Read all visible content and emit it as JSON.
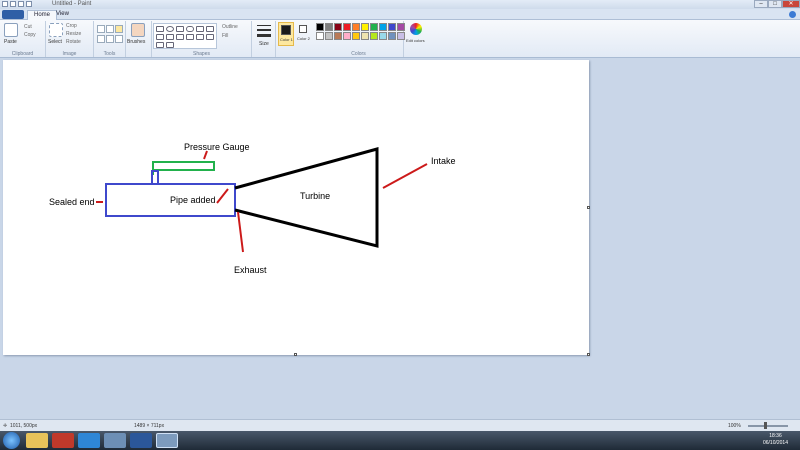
{
  "window": {
    "title": "Untitled - Paint"
  },
  "tabs": [
    {
      "label": "Home"
    },
    {
      "label": "View"
    }
  ],
  "ribbon": {
    "clipboard": {
      "paste_label": "Paste",
      "cut_label": "Cut",
      "copy_label": "Copy",
      "group_label": "Clipboard"
    },
    "image": {
      "select_label": "Select",
      "crop_label": "Crop",
      "resize_label": "Resize",
      "rotate_label": "Rotate",
      "group_label": "Image"
    },
    "tools": {
      "group_label": "Tools"
    },
    "brushes": {
      "label": "Brushes"
    },
    "shapes": {
      "outline_label": "Outline",
      "fill_label": "Fill",
      "group_label": "Shapes"
    },
    "size": {
      "label": "Size"
    },
    "color1": {
      "label": "Color 1",
      "value": "#1a1a1a"
    },
    "color2": {
      "label": "Color 2",
      "value": "#ffffff"
    },
    "colors": {
      "group_label": "Colors",
      "palette": [
        "#000000",
        "#7f7f7f",
        "#880015",
        "#ed1c24",
        "#ff7f27",
        "#fff200",
        "#22b14c",
        "#00a2e8",
        "#3f48cc",
        "#a349a4",
        "#ffffff",
        "#c3c3c3",
        "#b97a57",
        "#ffaec9",
        "#ffc90e",
        "#efe4b0",
        "#b5e61d",
        "#99d9ea",
        "#7092be",
        "#c8bfe7"
      ]
    },
    "edit_colors": {
      "label": "Edit colors"
    }
  },
  "drawing": {
    "labels": {
      "pressure_gauge": "Pressure Gauge",
      "sealed_end": "Sealed end",
      "pipe_added": "Pipe added",
      "turbine": "Turbine",
      "intake": "Intake",
      "exhaust": "Exhaust"
    },
    "colors": {
      "pipe": "#3f48cc",
      "gauge": "#22b14c",
      "turbine": "#000000",
      "pointer": "#cc1a1a"
    }
  },
  "statusbar": {
    "cursor_position": "1011, 500px",
    "canvas_size": "1489 × 711px",
    "zoom": "100%"
  },
  "taskbar": {
    "time": "18:36",
    "date": "06/10/2014"
  }
}
